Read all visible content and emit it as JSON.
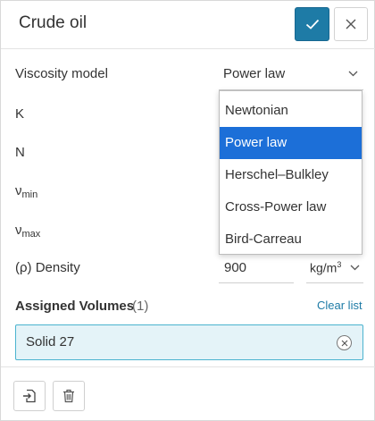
{
  "header": {
    "title": "Crude oil",
    "confirm_icon": "checkmark-icon",
    "close_icon": "close-icon"
  },
  "form": {
    "viscosity_model": {
      "label": "Viscosity model",
      "value": "Power law",
      "options": [
        "Newtonian",
        "Power law",
        "Herschel–Bulkley",
        "Cross-Power law",
        "Bird-Carreau"
      ],
      "selected_index": 1
    },
    "k_label": "K",
    "n_label": "N",
    "nu_min": {
      "base": "ν",
      "sub": "min"
    },
    "nu_max": {
      "base": "ν",
      "sub": "max"
    },
    "density": {
      "label": "(ρ) Density",
      "value": "900",
      "unit_base": "kg/m",
      "unit_exp": "3"
    }
  },
  "assigned_volumes": {
    "title": "Assigned Volumes",
    "count": "(1)",
    "clear_label": "Clear list",
    "items": [
      "Solid 27"
    ]
  },
  "footer": {
    "assign_icon": "import-icon",
    "delete_icon": "trash-icon"
  },
  "colors": {
    "accent": "#1e7ba6",
    "selected_option": "#1c6fd8",
    "chip_bg": "#e4f3f8",
    "chip_border": "#4bb3cf"
  }
}
